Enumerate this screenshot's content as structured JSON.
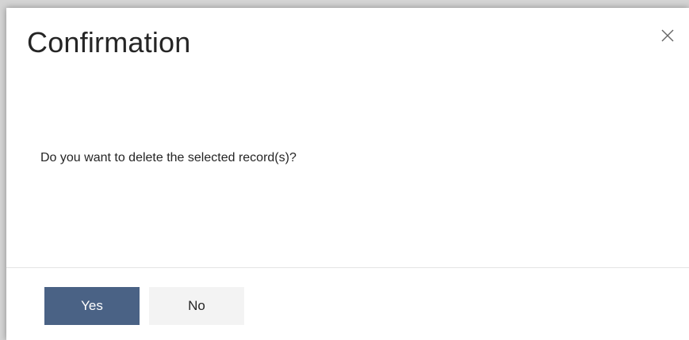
{
  "dialog": {
    "title": "Confirmation",
    "close_icon": "close-icon",
    "message": "Do you want to delete the selected record(s)?",
    "buttons": {
      "yes_label": "Yes",
      "no_label": "No"
    },
    "colors": {
      "primary": "#4a6285",
      "secondary": "#f3f3f3",
      "text": "#252525"
    }
  }
}
